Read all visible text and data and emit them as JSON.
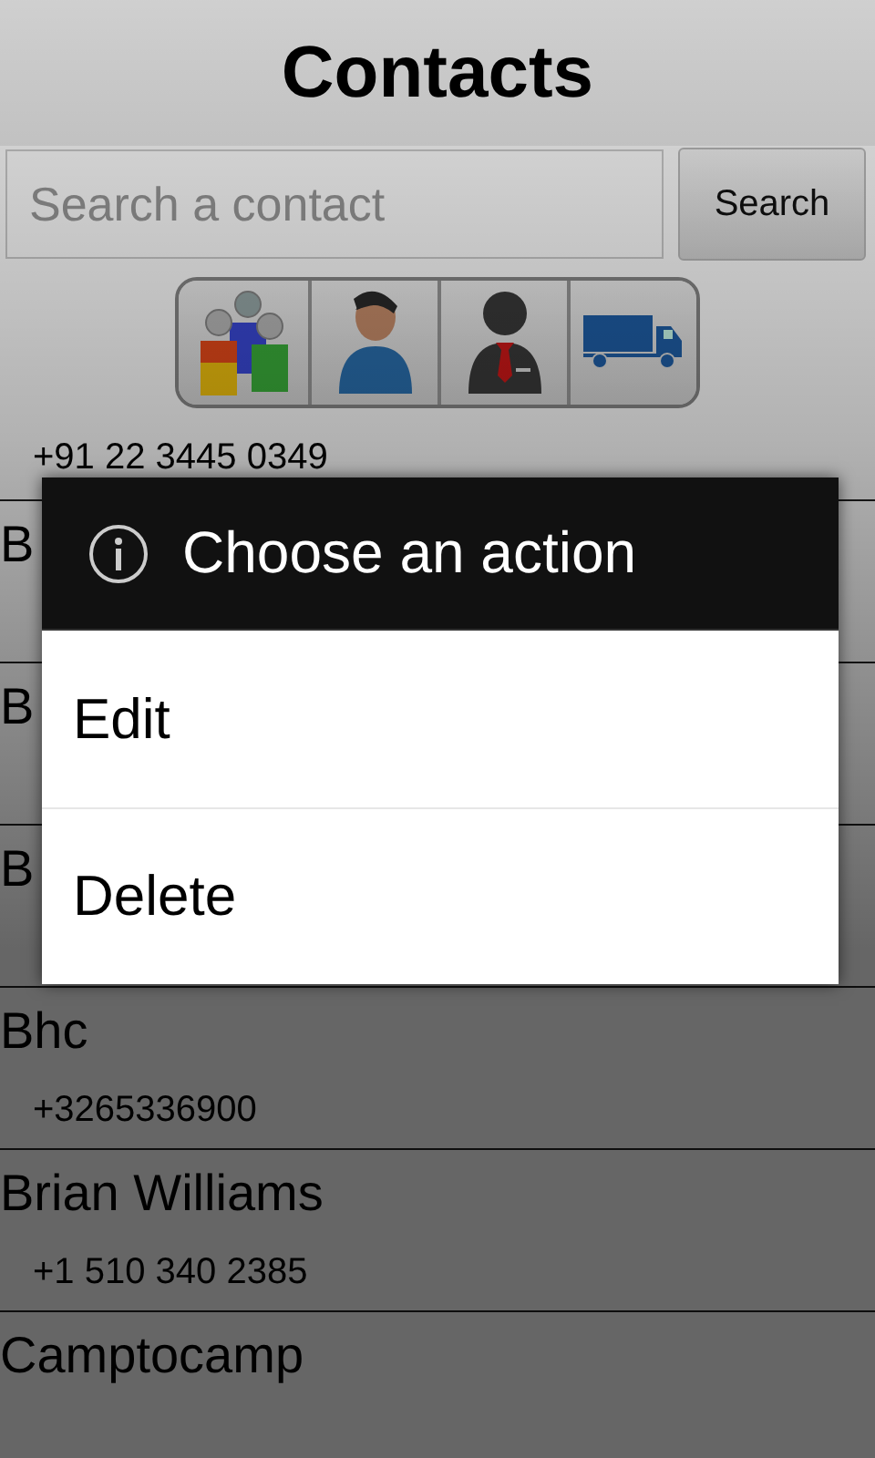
{
  "header": {
    "title": "Contacts"
  },
  "search": {
    "placeholder": "Search a contact",
    "button": "Search"
  },
  "filters": [
    {
      "kind": "group"
    },
    {
      "kind": "person"
    },
    {
      "kind": "business"
    },
    {
      "kind": "truck"
    }
  ],
  "contacts": [
    {
      "phone": "+91 22 3445 0349"
    },
    {
      "name": "B"
    },
    {
      "name": "B"
    },
    {
      "name": "B"
    },
    {
      "name": "Bhc",
      "phone": "+3265336900"
    },
    {
      "name": "Brian Williams",
      "phone": "+1 510 340 2385"
    },
    {
      "name": "Camptocamp"
    }
  ],
  "dialog": {
    "title": "Choose an action",
    "actions": [
      "Edit",
      "Delete"
    ]
  }
}
